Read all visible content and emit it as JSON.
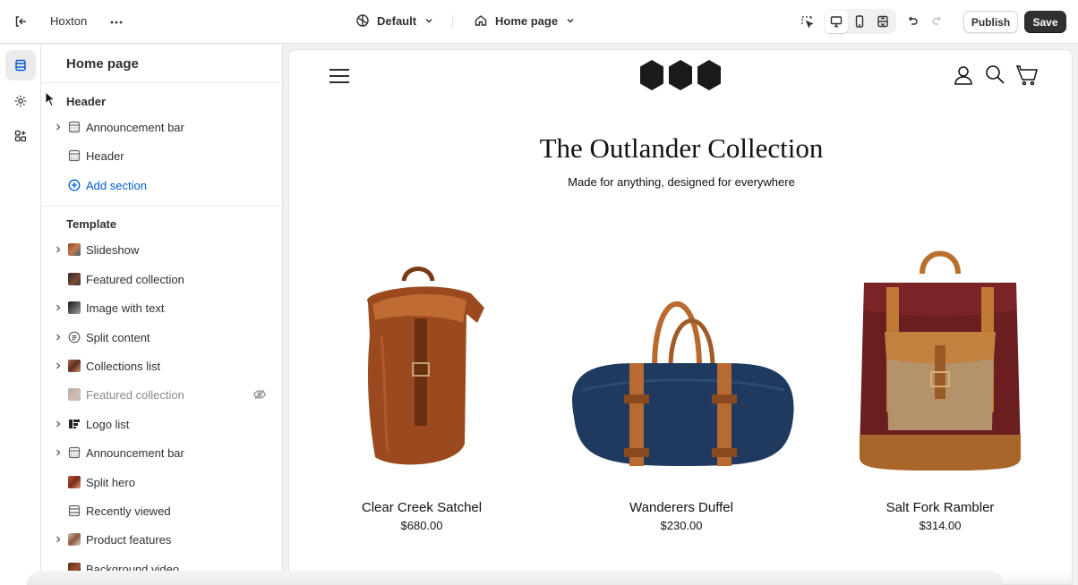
{
  "app": {
    "store_name": "Hoxton",
    "theme_label": "Default",
    "page_label": "Home page",
    "publish_label": "Publish",
    "save_label": "Save"
  },
  "icons": {
    "exit": "exit-icon",
    "more": "more-dots-icon",
    "theme": "palette-icon",
    "page": "home-icon",
    "inspect": "inspect-icon",
    "desktop": "desktop-icon",
    "mobile": "mobile-icon",
    "fullwidth": "fullwidth-icon",
    "undo": "undo-icon",
    "redo": "redo-icon"
  },
  "colors": {
    "accent": "#005bd3",
    "save_bg": "#303030",
    "hidden_text": "#8a8a8a"
  },
  "sidebar": {
    "title": "Home page",
    "header_group": {
      "title": "Header",
      "items": [
        {
          "label": "Announcement bar",
          "icon": "section-icon",
          "expandable": true
        },
        {
          "label": "Header",
          "icon": "section-icon",
          "expandable": false
        }
      ],
      "add_label": "Add section"
    },
    "template_group": {
      "title": "Template",
      "items": [
        {
          "label": "Slideshow",
          "icon": "image-thumb",
          "expandable": true
        },
        {
          "label": "Featured collection",
          "icon": "image-thumb",
          "expandable": false
        },
        {
          "label": "Image with text",
          "icon": "image-thumb",
          "expandable": true
        },
        {
          "label": "Split content",
          "icon": "text-icon",
          "expandable": true
        },
        {
          "label": "Collections list",
          "icon": "image-thumb",
          "expandable": true
        },
        {
          "label": "Featured collection",
          "icon": "image-thumb",
          "expandable": false,
          "hidden": true
        },
        {
          "label": "Logo list",
          "icon": "logo-thumb",
          "expandable": true
        },
        {
          "label": "Announcement bar",
          "icon": "section-icon",
          "expandable": true
        },
        {
          "label": "Split hero",
          "icon": "image-thumb",
          "expandable": false
        },
        {
          "label": "Recently viewed",
          "icon": "section-icon",
          "expandable": false
        },
        {
          "label": "Product features",
          "icon": "image-thumb",
          "expandable": true
        },
        {
          "label": "Background video",
          "icon": "image-thumb",
          "expandable": false
        }
      ]
    }
  },
  "preview": {
    "heading": "The Outlander Collection",
    "subheading": "Made for anything, designed for everywhere",
    "products": [
      {
        "name": "Clear Creek Satchel",
        "price": "$680.00"
      },
      {
        "name": "Wanderers Duffel",
        "price": "$230.00"
      },
      {
        "name": "Salt Fork Rambler",
        "price": "$314.00"
      }
    ]
  }
}
